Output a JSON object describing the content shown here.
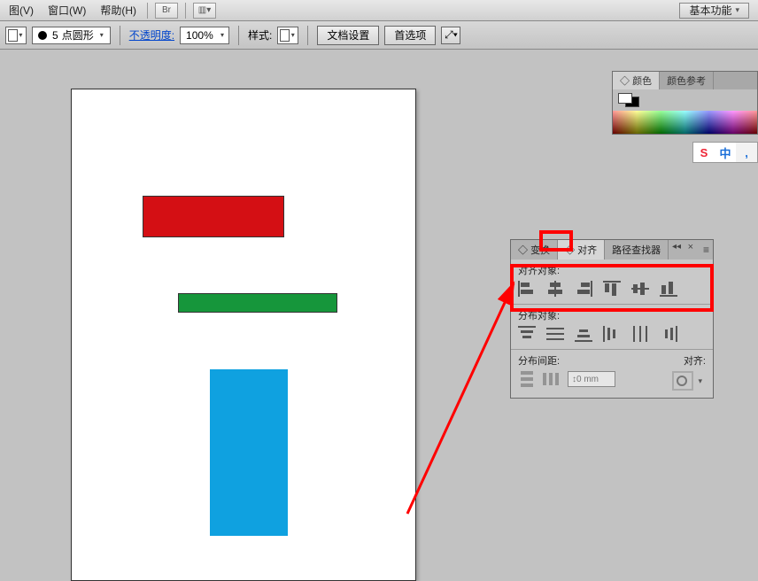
{
  "menubar": {
    "items": [
      {
        "label": "图(V)"
      },
      {
        "label": "窗口(W)"
      },
      {
        "label": "帮助(H)"
      }
    ],
    "right_button": "基本功能"
  },
  "optbar": {
    "stroke_size": "5",
    "brush_name": "点圆形",
    "opacity_label": "不透明度:",
    "opacity_value": "100%",
    "style_label": "样式:",
    "doc_setup": "文档设置",
    "prefs": "首选项"
  },
  "color_panel": {
    "tabs": [
      "颜色",
      "颜色参考"
    ]
  },
  "ime": [
    "S",
    "中",
    ","
  ],
  "align_panel": {
    "tabs": [
      "变换",
      "对齐",
      "路径查找器"
    ],
    "sec1": "对齐对象:",
    "sec2": "分布对象:",
    "sec3": "分布间距:",
    "align_label": "对齐:",
    "gap_value": "0 mm"
  }
}
